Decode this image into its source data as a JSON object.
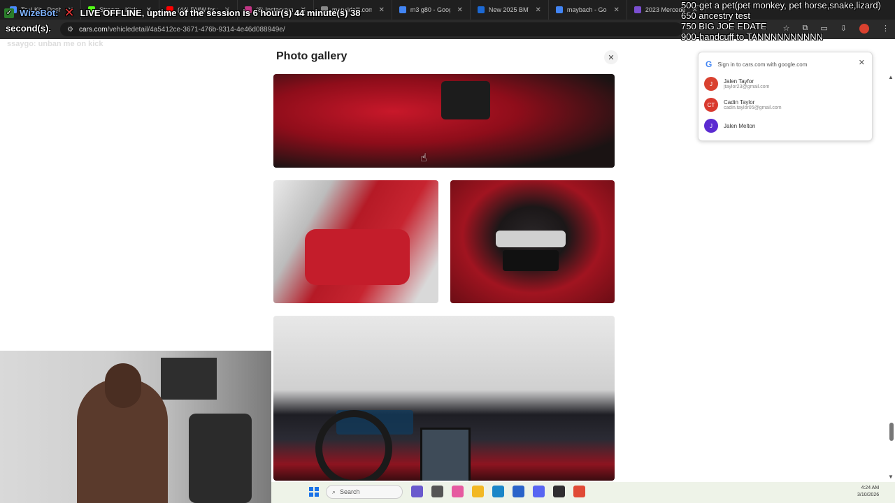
{
  "browser": {
    "tabs": [
      {
        "label": "Tool Kit - Dash",
        "color": "#4a8bff"
      },
      {
        "label": "Stream - Kick Chat",
        "color": "#53fc18"
      },
      {
        "label": "(44) BMW for Sale",
        "color": "#ff0000"
      },
      {
        "label": "(8) Instagram",
        "color": "#c13584"
      },
      {
        "label": "mansidalli.com",
        "color": "#888888"
      },
      {
        "label": "m3 g80 - Google",
        "color": "#4285f4"
      },
      {
        "label": "New 2025 BMW M",
        "color": "#1c69d4"
      },
      {
        "label": "maybach - Google",
        "color": "#4285f4"
      },
      {
        "label": "2023 Mercedes",
        "color": "#7b4fd1"
      }
    ],
    "url_host": "cars.com",
    "url_path": "/vehicledetail/4a5412ce-3671-476b-9314-4e46d088949e/"
  },
  "overlay": {
    "bot_name": "WizeBot:",
    "bot_message": "LIVE OFFLINE, uptime of the session is 6 hour(s) 44 minute(s) 38",
    "bot_message_cont": "second(s).",
    "chat_ghost": "ssaygo: unban me on kick",
    "goals": [
      "500-get a pet(pet monkey, pet horse,snake,lizard)",
      "650 ancestry test",
      "750 BIG JOE EDATE",
      "900-handcuff to TANNNNNNNNNN"
    ]
  },
  "gallery": {
    "title": "Photo gallery",
    "close_label": "✕",
    "photos": [
      {
        "name": "rear-seat-console"
      },
      {
        "name": "rear-bench-seat"
      },
      {
        "name": "rear-air-vents"
      },
      {
        "name": "dashboard-cockpit"
      }
    ]
  },
  "google_popup": {
    "heading": "Sign in to cars.com with google.com",
    "accounts": [
      {
        "name": "Jalen Tayfor",
        "email": "jtaylor23@gmail.com",
        "color": "#d9412f",
        "initials": "J"
      },
      {
        "name": "Cadin Taylor",
        "email": "cadin.taylor05@gmail.com",
        "color": "#d93a2f",
        "initials": "CT"
      },
      {
        "name": "Jalen Melton",
        "email": "",
        "color": "#5b2bd1",
        "initials": "J"
      }
    ]
  },
  "taskbar": {
    "search_placeholder": "Search",
    "time": "4:24 AM",
    "date": "3/10/2026",
    "apps": [
      {
        "name": "copilot",
        "color": "#6a5acd"
      },
      {
        "name": "task-view",
        "color": "#555555"
      },
      {
        "name": "widgets",
        "color": "#e65aa0"
      },
      {
        "name": "file-explorer",
        "color": "#f2b824"
      },
      {
        "name": "edge",
        "color": "#1b86c8"
      },
      {
        "name": "store",
        "color": "#2a63c9"
      },
      {
        "name": "discord",
        "color": "#5865f2"
      },
      {
        "name": "obs",
        "color": "#302e31"
      },
      {
        "name": "chrome",
        "color": "#e04a36"
      }
    ]
  }
}
